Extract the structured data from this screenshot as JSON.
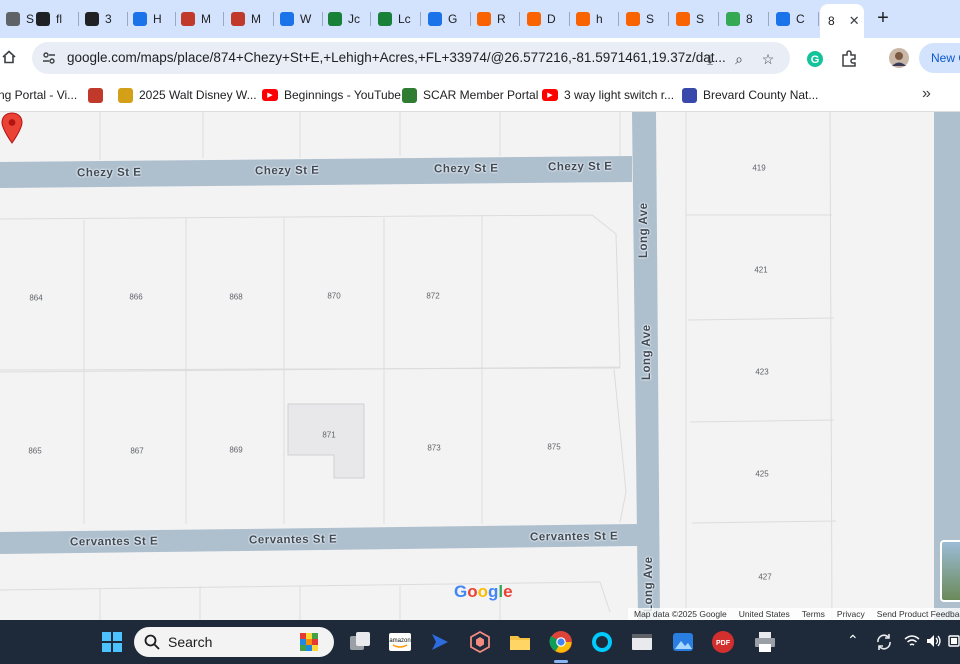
{
  "browser": {
    "tabs": [
      {
        "label": "S",
        "icon": "page-icon",
        "color": "#5f6368"
      },
      {
        "label": "fl",
        "icon": "arrow-circle-icon",
        "color": "#202124"
      },
      {
        "label": "3",
        "icon": "arrow-circle-icon",
        "color": "#202124"
      },
      {
        "label": "H",
        "icon": "gear-icon",
        "color": "#1a73e8"
      },
      {
        "label": "M",
        "icon": "cube-icon",
        "color": "#c0392b"
      },
      {
        "label": "M",
        "icon": "cube-icon",
        "color": "#c0392b"
      },
      {
        "label": "W",
        "icon": "wave-icon",
        "color": "#1a73e8"
      },
      {
        "label": "Jc",
        "icon": "sheets-icon",
        "color": "#188038"
      },
      {
        "label": "Lc",
        "icon": "sheets-icon",
        "color": "#188038"
      },
      {
        "label": "G",
        "icon": "calendar-icon",
        "color": "#1a73e8"
      },
      {
        "label": "R",
        "icon": "home-depot-icon",
        "color": "#f96302"
      },
      {
        "label": "D",
        "icon": "home-depot-icon",
        "color": "#f96302"
      },
      {
        "label": "h",
        "icon": "home-depot-icon",
        "color": "#f96302"
      },
      {
        "label": "S",
        "icon": "home-depot-icon",
        "color": "#f96302"
      },
      {
        "label": "S",
        "icon": "home-depot-icon",
        "color": "#f96302"
      },
      {
        "label": "8",
        "icon": "maps-pin-icon",
        "color": "#34a853"
      },
      {
        "label": "C",
        "icon": "docs-icon",
        "color": "#1a73e8"
      },
      {
        "label": "8",
        "icon": "",
        "color": "#202124"
      }
    ],
    "active_tab_close": "✕",
    "new_tab": "+",
    "url": "google.com/maps/place/874+Chezy+St+E,+Lehigh+Acres,+FL+33974/@26.577216,-81.5971461,19.37z/dat...",
    "new_button": "New C"
  },
  "bookmarks": [
    {
      "label": "ng Portal - Vi...",
      "icon": "none"
    },
    {
      "label": "",
      "icon": "cube-icon"
    },
    {
      "label": "2025 Walt Disney W...",
      "icon": "disney-icon"
    },
    {
      "label": "Beginnings - YouTube",
      "icon": "youtube-icon"
    },
    {
      "label": "SCAR Member Portal",
      "icon": "scar-icon"
    },
    {
      "label": "3 way light switch r...",
      "icon": "youtube-icon"
    },
    {
      "label": "Brevard County Nat...",
      "icon": "brevard-icon"
    }
  ],
  "bookmarks_more": "»",
  "map": {
    "streets": {
      "chezy": [
        "Chezy St E",
        "Chezy St E",
        "Chezy St E",
        "Chezy St E"
      ],
      "cervantes": [
        "Cervantes St E",
        "Cervantes St E",
        "Cervantes St E"
      ],
      "long": [
        "Long Ave",
        "Long Ave",
        "Long Ave"
      ]
    },
    "lots_north": [
      "864",
      "866",
      "868",
      "870",
      "872"
    ],
    "lots_south": [
      "865",
      "867",
      "869",
      "871",
      "873",
      "875"
    ],
    "lots_east": [
      "419",
      "421",
      "423",
      "425",
      "427"
    ],
    "logo": "Google",
    "attribution": [
      "Map data ©2025 Google",
      "United States",
      "Terms",
      "Privacy",
      "Send Product Feedback"
    ],
    "colors": {
      "road": "#aebfce",
      "lot": "#f4f3f4",
      "lot_line": "#dcdcdc",
      "building": "#e8e8ea",
      "pin": "#ea4335"
    }
  },
  "taskbar": {
    "search_label": "Search",
    "apps": [
      "windows-icon",
      "search-icon",
      "task-view-icon",
      "amazon-icon",
      "arrow-app-icon",
      "cube-app-icon",
      "file-explorer-icon",
      "chrome-icon",
      "alexa-icon",
      "window-icon",
      "photos-icon",
      "pdf-icon",
      "printer-icon"
    ]
  }
}
